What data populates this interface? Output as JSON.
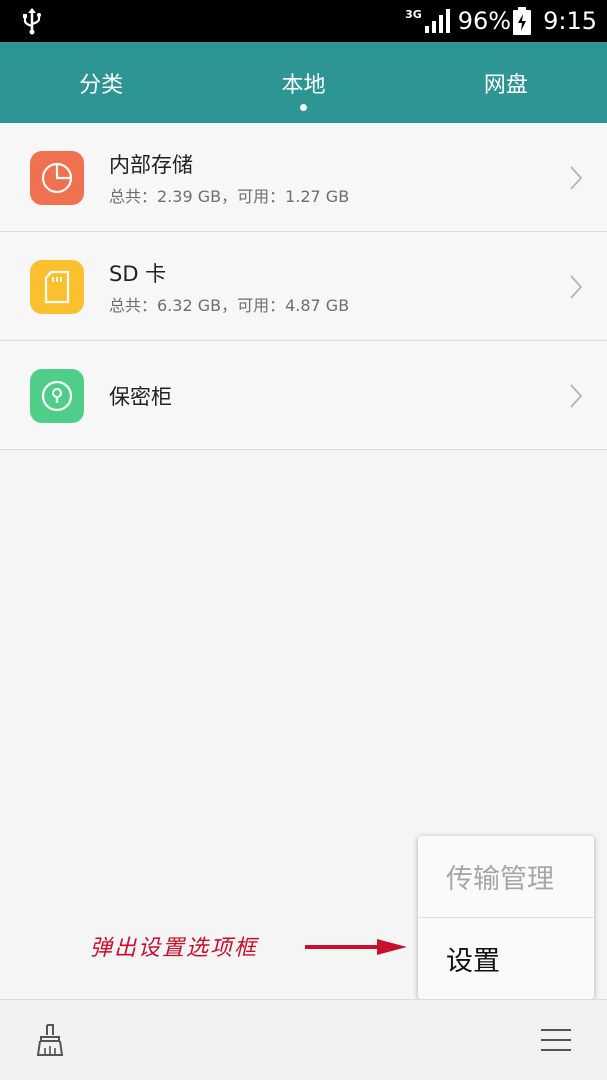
{
  "status_bar": {
    "network": "3G",
    "battery_percent": "96%",
    "time": "9:15",
    "icons": [
      "usb-icon",
      "signal-icon",
      "battery-charging-icon"
    ]
  },
  "tabs": [
    {
      "label": "分类",
      "active": false
    },
    {
      "label": "本地",
      "active": true
    },
    {
      "label": "网盘",
      "active": false
    }
  ],
  "storage": [
    {
      "title": "内部存储",
      "subtitle": "总共：2.39 GB，可用：1.27 GB",
      "icon": "pie-chart-icon",
      "color": "#f0714f"
    },
    {
      "title": "SD 卡",
      "subtitle": "总共：6.32 GB，可用：4.87 GB",
      "icon": "sd-card-icon",
      "color": "#fbc02d"
    },
    {
      "title": "保密柜",
      "subtitle": "",
      "icon": "lock-icon",
      "color": "#4fce8a"
    }
  ],
  "menu": {
    "items": [
      {
        "label": "传输管理",
        "enabled": false
      },
      {
        "label": "设置",
        "enabled": true
      }
    ]
  },
  "annotation": {
    "text": "弹出设置选项框",
    "color": "#c8102e"
  },
  "bottom_bar": {
    "icons": [
      "clean-brush-icon",
      "menu-icon"
    ]
  },
  "colors": {
    "header": "#2e9595",
    "background": "#f5f5f5"
  }
}
